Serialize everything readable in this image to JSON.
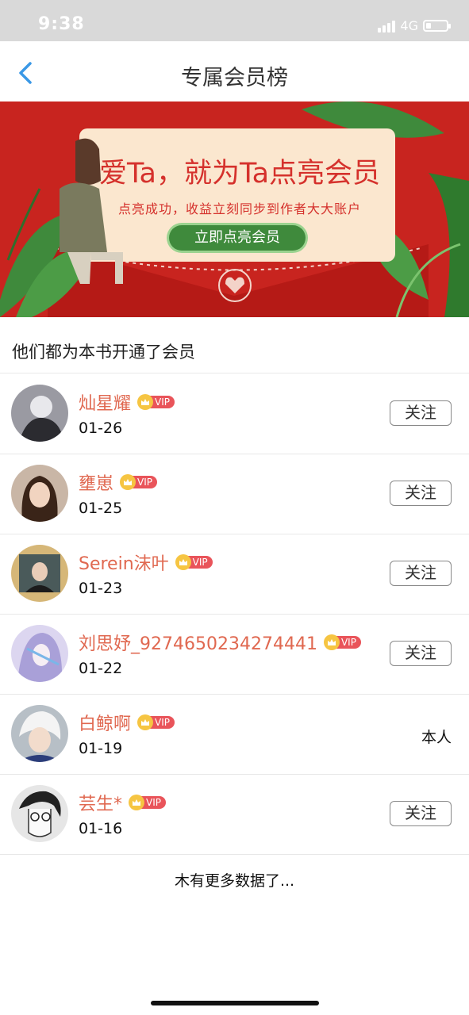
{
  "status_bar": {
    "time": "9:38",
    "network": "4G",
    "battery_level": 0.25
  },
  "nav": {
    "back_icon": "chevron-left-icon",
    "title": "专属会员榜",
    "accent_color": "#3a98e6"
  },
  "banner": {
    "title": "爱Ta，就为Ta点亮会员",
    "subtitle": "点亮成功，收益立刻同步到作者大大账户",
    "button_label": "立即点亮会员",
    "background_color": "#c8241f",
    "accent_color": "#3f8a3c"
  },
  "section_title": "他们都为本书开通了会员",
  "vip_label": "VIP",
  "members": [
    {
      "name": "灿星耀",
      "date": "01-26",
      "action": "关注",
      "is_self": false
    },
    {
      "name": "壅崽",
      "date": "01-25",
      "action": "关注",
      "is_self": false
    },
    {
      "name": "Serein沫叶",
      "date": "01-23",
      "action": "关注",
      "is_self": false
    },
    {
      "name": "刘思妤_9274650234274441",
      "date": "01-22",
      "action": "关注",
      "is_self": false
    },
    {
      "name": "白鲸啊",
      "date": "01-19",
      "action": "本人",
      "is_self": true
    },
    {
      "name": "芸生*",
      "date": "01-16",
      "action": "关注",
      "is_self": false
    }
  ],
  "footer_text": "木有更多数据了..."
}
